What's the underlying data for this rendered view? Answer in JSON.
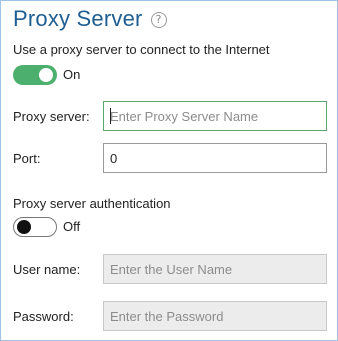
{
  "header": {
    "title": "Proxy Server",
    "help_icon": "?"
  },
  "proxy": {
    "use_label": "Use a proxy server to connect to the Internet",
    "enabled": true,
    "state_label": "On",
    "server_label": "Proxy server:",
    "server_placeholder": "Enter Proxy Server Name",
    "server_value": "",
    "port_label": "Port:",
    "port_value": "0"
  },
  "auth": {
    "label": "Proxy server authentication",
    "enabled": false,
    "state_label": "Off",
    "username_label": "User name:",
    "username_placeholder": "Enter the User Name",
    "password_label": "Password:",
    "password_placeholder": "Enter the Password"
  },
  "colors": {
    "title": "#1f5e93",
    "toggle_on": "#4caf6e",
    "active_border": "#5aa86b",
    "panel_border": "#9ec3e6",
    "disabled_bg": "#ececec"
  },
  "icons": {
    "help": "question-circle-icon"
  }
}
